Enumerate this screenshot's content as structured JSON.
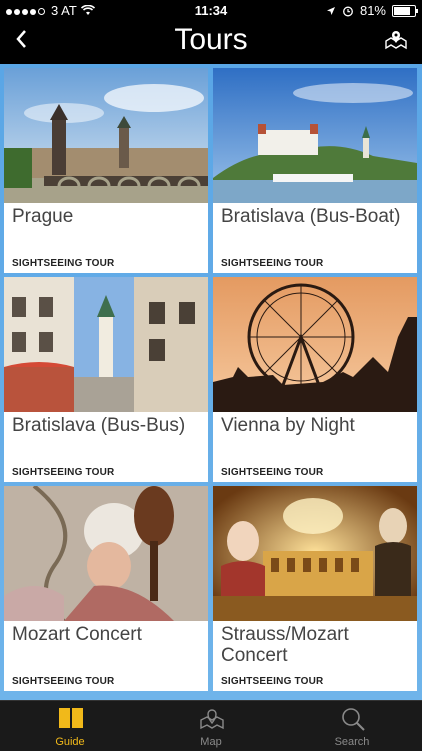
{
  "status_bar": {
    "carrier": "3 AT",
    "time": "11:34",
    "battery": "81%",
    "battery_level": 0.81
  },
  "nav": {
    "title": "Tours",
    "back_icon": "chevron-left-icon",
    "map_icon": "map-pin-icon"
  },
  "tours": [
    {
      "title": "Prague",
      "category": "SIGHTSEEING TOUR"
    },
    {
      "title": "Bratislava (Bus-Boat)",
      "category": "SIGHTSEEING TOUR"
    },
    {
      "title": "Bratislava (Bus-Bus)",
      "category": "SIGHTSEEING TOUR"
    },
    {
      "title": "Vienna by Night",
      "category": "SIGHTSEEING TOUR"
    },
    {
      "title": "Mozart Concert",
      "category": "SIGHTSEEING TOUR"
    },
    {
      "title": "Strauss/Mozart Concert",
      "category": "SIGHTSEEING TOUR"
    }
  ],
  "tab_bar": {
    "items": [
      {
        "label": "Guide",
        "icon": "book-icon",
        "active": true
      },
      {
        "label": "Map",
        "icon": "map-icon",
        "active": false
      },
      {
        "label": "Search",
        "icon": "search-icon",
        "active": false
      }
    ],
    "active_color": "#f1b91a"
  }
}
